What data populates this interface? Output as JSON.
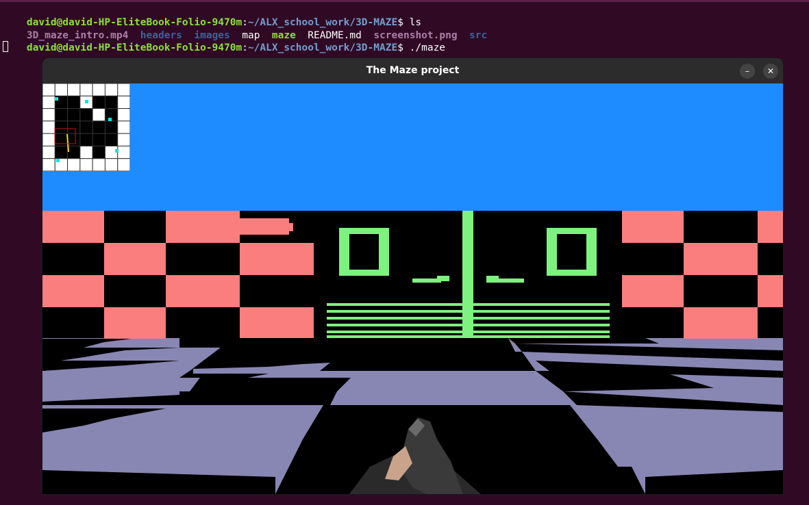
{
  "terminal": {
    "lines": [
      {
        "user": "david@david-HP-EliteBook-Folio-9470m",
        "colon": ":",
        "path": "~/ALX_school_work/3D-MAZE",
        "suffix": "$ ls"
      },
      {
        "user": "david@david-HP-EliteBook-Folio-9470m",
        "colon": ":",
        "path": "~/ALX_school_work/3D-MAZE",
        "suffix": "$ ./maze"
      }
    ],
    "ls_output": [
      {
        "name": "3D_maze_intro.mp4",
        "kind": "media"
      },
      {
        "name": "headers",
        "kind": "dir"
      },
      {
        "name": "images",
        "kind": "dir"
      },
      {
        "name": "map",
        "kind": "file"
      },
      {
        "name": "maze",
        "kind": "exec"
      },
      {
        "name": "README.md",
        "kind": "file"
      },
      {
        "name": "screenshot.png",
        "kind": "media"
      },
      {
        "name": "src",
        "kind": "dir"
      }
    ]
  },
  "window": {
    "title": "The Maze project",
    "minimize_label": "–",
    "close_label": "✕"
  },
  "scene": {
    "sky_color": "#1e8cff",
    "wall_pink": "#fa7e7e",
    "wall_green": "#7ef27e",
    "floor_color": "#8886b2",
    "dark": "#000000"
  },
  "minimap": {
    "grid": [
      [
        1,
        1,
        1,
        1,
        1,
        1,
        1
      ],
      [
        1,
        0,
        0,
        1,
        0,
        0,
        1
      ],
      [
        1,
        0,
        0,
        0,
        1,
        0,
        1
      ],
      [
        1,
        0,
        0,
        0,
        0,
        0,
        1
      ],
      [
        1,
        0,
        0,
        0,
        0,
        0,
        1
      ],
      [
        1,
        0,
        0,
        1,
        0,
        1,
        1
      ],
      [
        1,
        1,
        1,
        1,
        1,
        1,
        1
      ]
    ],
    "cell_color_wall": "#ffffff",
    "cell_color_floor": "#000000",
    "marker_color": "#00e5e5",
    "player_color": "#ffd700"
  }
}
